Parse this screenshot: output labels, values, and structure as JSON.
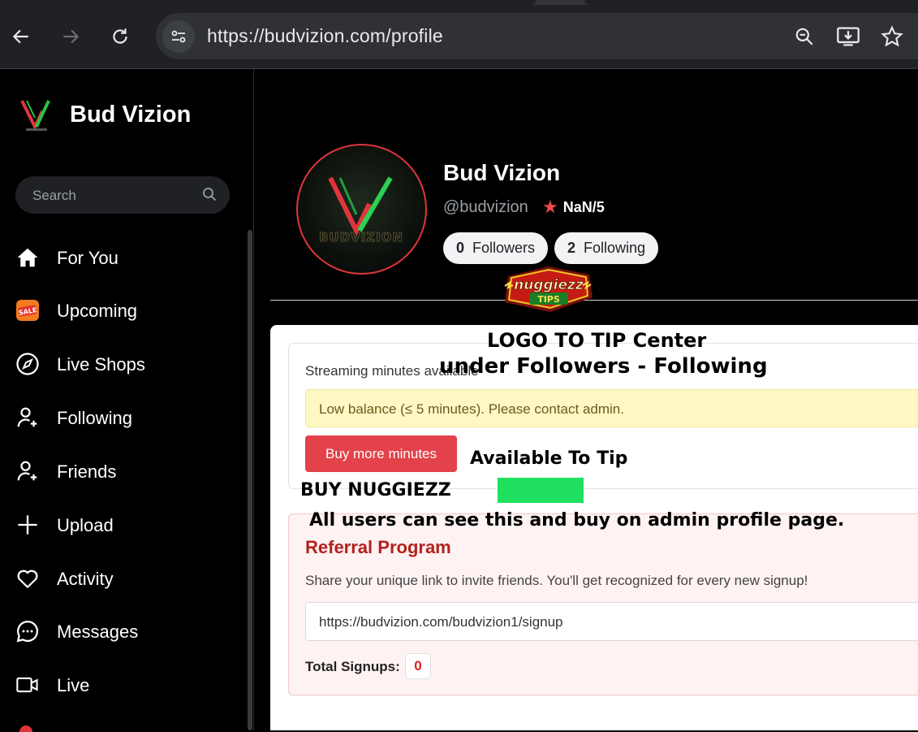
{
  "browser": {
    "url": "https://budvizion.com/profile",
    "icons": [
      "back-arrow-icon",
      "forward-arrow-icon",
      "reload-icon",
      "site-settings-icon",
      "zoom-icon",
      "install-app-icon",
      "bookmark-star-icon"
    ]
  },
  "sidebar": {
    "brand_name": "Bud Vizion",
    "search_placeholder": "Search",
    "items": [
      {
        "label": "For You",
        "icon": "home-icon"
      },
      {
        "label": "Upcoming",
        "icon": "sale-icon"
      },
      {
        "label": "Live Shops",
        "icon": "compass-icon"
      },
      {
        "label": "Following",
        "icon": "user-plus-icon"
      },
      {
        "label": "Friends",
        "icon": "user-plus-icon"
      },
      {
        "label": "Upload",
        "icon": "plus-icon"
      },
      {
        "label": "Activity",
        "icon": "heart-icon"
      },
      {
        "label": "Messages",
        "icon": "chat-bubble-icon"
      },
      {
        "label": "Live",
        "icon": "video-camera-icon"
      }
    ]
  },
  "profile": {
    "name": "Bud Vizion",
    "handle": "@budvizion",
    "rating": "NaN/5",
    "followers_count": "0",
    "followers_label": "Followers",
    "following_count": "2",
    "following_label": "Following"
  },
  "minutes_card": {
    "title": "Streaming minutes available",
    "warning": "Low balance (≤ 5 minutes). Please contact admin.",
    "buy_button": "Buy more minutes"
  },
  "referral": {
    "title": "Referral Program",
    "description": "Share your unique link to invite friends. You'll get recognized for every new signup!",
    "link": "https://budvizion.com/budvizion1/signup",
    "signups_label": "Total Signups:",
    "signups_count": "0"
  },
  "annotations": {
    "badge_top": "nuggiezz",
    "badge_bottom": "TIPS",
    "line1": "LOGO TO TIP Center",
    "line2": "under Followers - Following",
    "available": "Available To Tip",
    "buy": "BUY NUGGIEZZ",
    "all_users": "All users can see this and buy on admin profile page."
  },
  "colors": {
    "accent_red": "#e3424a",
    "warning_bg": "#fff8c5",
    "referral_bg": "#fff2f2",
    "tip_green": "#1fe15f"
  }
}
